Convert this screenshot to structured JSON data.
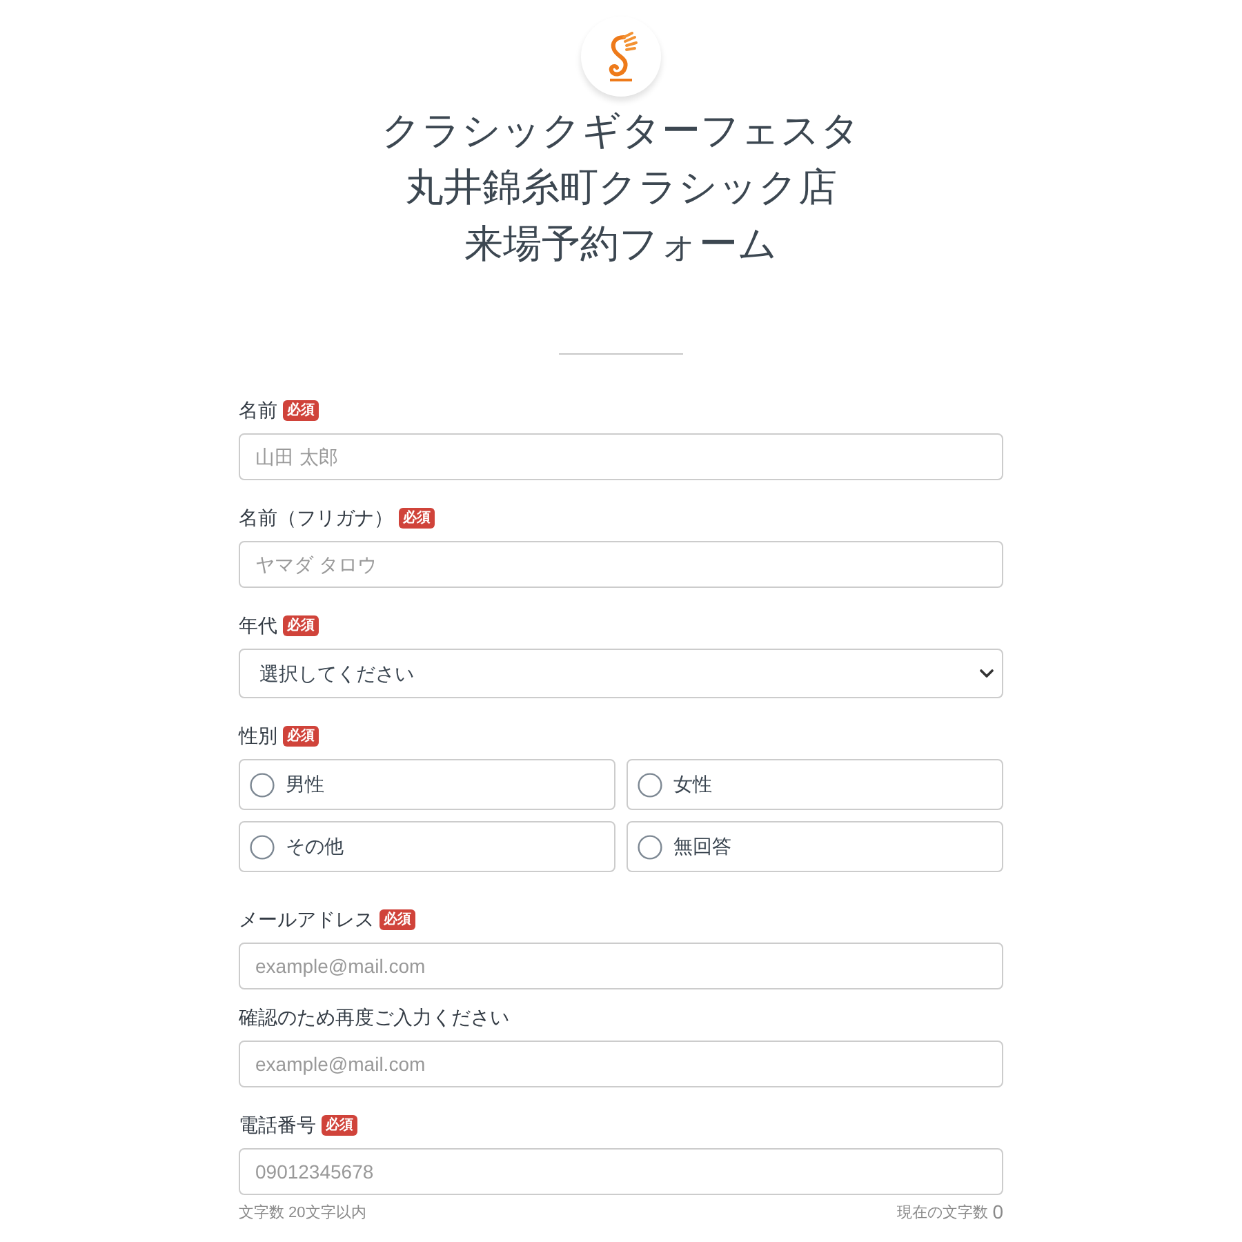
{
  "title": [
    "クラシックギターフェスタ",
    "丸井錦糸町クラシック店",
    "来場予約フォーム"
  ],
  "fields": [
    {
      "kind": "input",
      "label": "名前",
      "badge": "必須",
      "placeholder": "山田 太郎"
    },
    {
      "kind": "input",
      "label": "名前（フリガナ）",
      "badge": "必須",
      "placeholder": "ヤマダ タロウ"
    },
    {
      "kind": "select",
      "label": "年代",
      "badge": "必須",
      "value": "選択してください"
    },
    {
      "kind": "radio",
      "label": "性別",
      "badge": "必須",
      "options": [
        {
          "label": "男性",
          "selected": false
        },
        {
          "label": "女性",
          "selected": false
        },
        {
          "label": "その他",
          "selected": false
        },
        {
          "label": "無回答",
          "selected": false
        }
      ]
    },
    {
      "kind": "input",
      "label": "メールアドレス",
      "badge": "必須",
      "placeholder": "example@mail.com",
      "confirm": {
        "label": "確認のため再度ご入力ください",
        "placeholder": "example@mail.com"
      }
    },
    {
      "kind": "input",
      "label": "電話番号",
      "badge": "必須",
      "placeholder": "09012345678",
      "hint": "文字数 20文字以内",
      "counter_label": "現在の文字数",
      "counter": "0"
    }
  ]
}
